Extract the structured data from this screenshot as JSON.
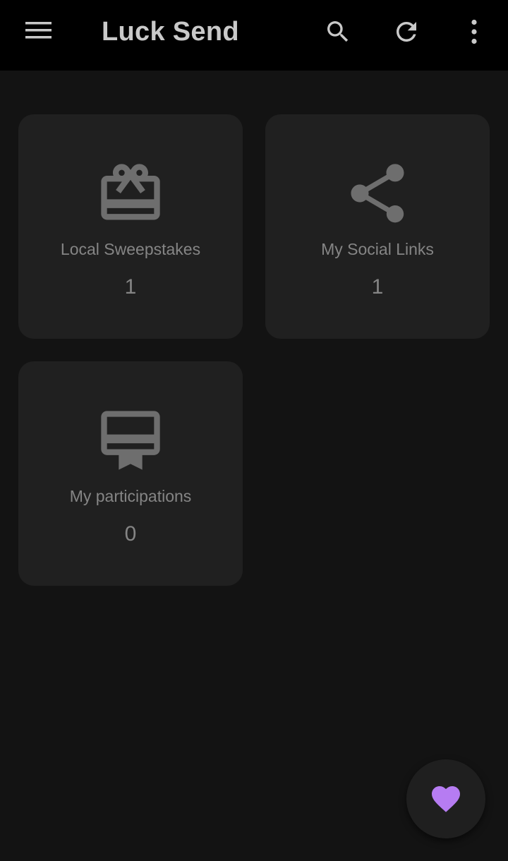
{
  "app": {
    "title": "Luck Send"
  },
  "toolbar": {
    "menu_icon": "menu-icon",
    "search_icon": "search-icon",
    "refresh_icon": "refresh-icon",
    "more_icon": "more-vert-icon"
  },
  "cards": [
    {
      "icon": "gift-card-icon",
      "label": "Local Sweepstakes",
      "count": "1"
    },
    {
      "icon": "share-icon",
      "label": "My Social Links",
      "count": "1"
    },
    {
      "icon": "card-membership-icon",
      "label": "My participations",
      "count": "0"
    }
  ],
  "fab": {
    "icon": "heart-icon",
    "color": "#b67cf2"
  },
  "colors": {
    "background": "#131313",
    "appbar": "#000000",
    "card": "#202020",
    "icon": "#6e6e6e",
    "text": "#858585",
    "accent": "#b67cf2"
  }
}
